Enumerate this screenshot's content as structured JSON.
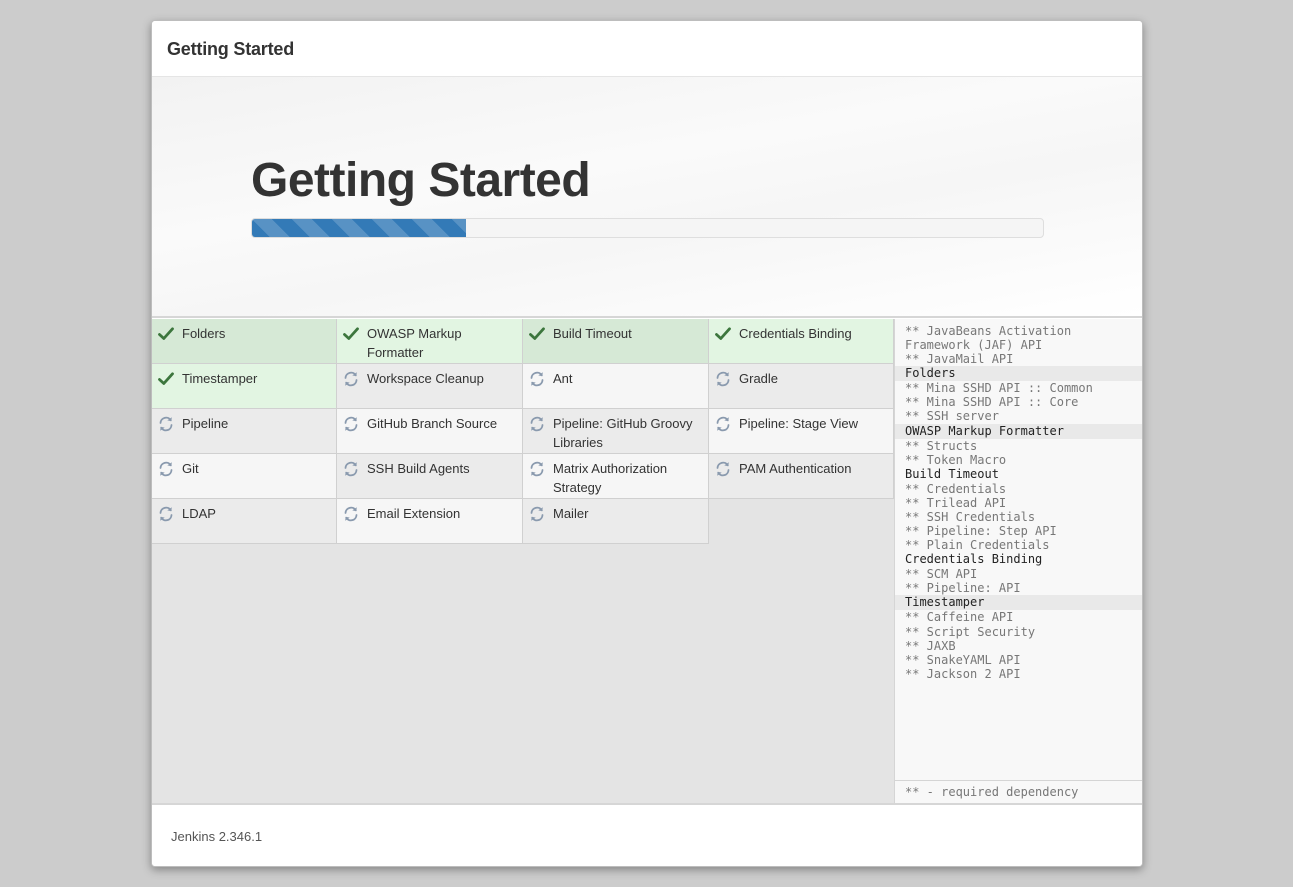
{
  "header": {
    "title": "Getting Started"
  },
  "hero": {
    "title": "Getting Started",
    "progress_fraction": 0.27
  },
  "plugins": [
    {
      "name": "Folders",
      "status": "success"
    },
    {
      "name": "OWASP Markup Formatter",
      "status": "success"
    },
    {
      "name": "Build Timeout",
      "status": "success"
    },
    {
      "name": "Credentials Binding",
      "status": "success"
    },
    {
      "name": "Timestamper",
      "status": "success"
    },
    {
      "name": "Workspace Cleanup",
      "status": "pending"
    },
    {
      "name": "Ant",
      "status": "pending"
    },
    {
      "name": "Gradle",
      "status": "pending"
    },
    {
      "name": "Pipeline",
      "status": "pending"
    },
    {
      "name": "GitHub Branch Source",
      "status": "pending"
    },
    {
      "name": "Pipeline: GitHub Groovy Libraries",
      "status": "pending"
    },
    {
      "name": "Pipeline: Stage View",
      "status": "pending"
    },
    {
      "name": "Git",
      "status": "pending"
    },
    {
      "name": "SSH Build Agents",
      "status": "pending"
    },
    {
      "name": "Matrix Authorization Strategy",
      "status": "pending"
    },
    {
      "name": "PAM Authentication",
      "status": "pending"
    },
    {
      "name": "LDAP",
      "status": "pending"
    },
    {
      "name": "Email Extension",
      "status": "pending"
    },
    {
      "name": "Mailer",
      "status": "pending"
    }
  ],
  "log": [
    {
      "text": "** JavaBeans Activation Framework (JAF) API",
      "header": false
    },
    {
      "text": "** JavaMail API",
      "header": false
    },
    {
      "text": "Folders",
      "header": true,
      "shade": true
    },
    {
      "text": "** Mina SSHD API :: Common",
      "header": false
    },
    {
      "text": "** Mina SSHD API :: Core",
      "header": false
    },
    {
      "text": "** SSH server",
      "header": false
    },
    {
      "text": "OWASP Markup Formatter",
      "header": true,
      "shade": true
    },
    {
      "text": "** Structs",
      "header": false
    },
    {
      "text": "** Token Macro",
      "header": false
    },
    {
      "text": "Build Timeout",
      "header": true,
      "shade": false
    },
    {
      "text": "** Credentials",
      "header": false
    },
    {
      "text": "** Trilead API",
      "header": false
    },
    {
      "text": "** SSH Credentials",
      "header": false
    },
    {
      "text": "** Pipeline: Step API",
      "header": false
    },
    {
      "text": "** Plain Credentials",
      "header": false
    },
    {
      "text": "Credentials Binding",
      "header": true,
      "shade": false
    },
    {
      "text": "** SCM API",
      "header": false
    },
    {
      "text": "** Pipeline: API",
      "header": false
    },
    {
      "text": "Timestamper",
      "header": true,
      "shade": true
    },
    {
      "text": "** Caffeine API",
      "header": false
    },
    {
      "text": "** Script Security",
      "header": false
    },
    {
      "text": "** JAXB",
      "header": false
    },
    {
      "text": "** SnakeYAML API",
      "header": false
    },
    {
      "text": "** Jackson 2 API",
      "header": false
    }
  ],
  "log_footer": "** - required dependency",
  "footer": {
    "version": "Jenkins 2.346.1"
  },
  "icons": {
    "success": "checkmark-icon",
    "pending": "refresh-icon"
  },
  "colors": {
    "accent": "#337ab7",
    "success_icon": "#3c763d",
    "pending_icon": "#8a9aae"
  }
}
